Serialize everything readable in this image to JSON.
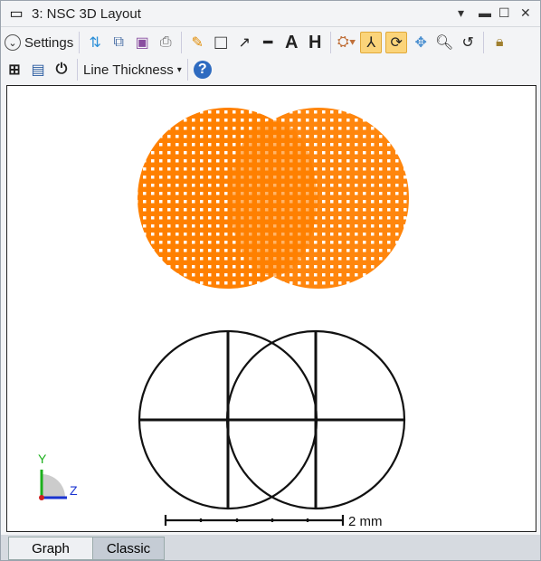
{
  "window": {
    "title": "3: NSC 3D Layout"
  },
  "toolbar": {
    "settings_label": "Settings",
    "line_thickness_label": "Line Thickness"
  },
  "plot": {
    "scale_label": "2 mm",
    "axis_y": "Y",
    "axis_z": "Z",
    "mesh_color": "#ff8000"
  },
  "tabs": [
    {
      "label": "Graph",
      "active": true
    },
    {
      "label": "Classic",
      "active": false
    }
  ]
}
